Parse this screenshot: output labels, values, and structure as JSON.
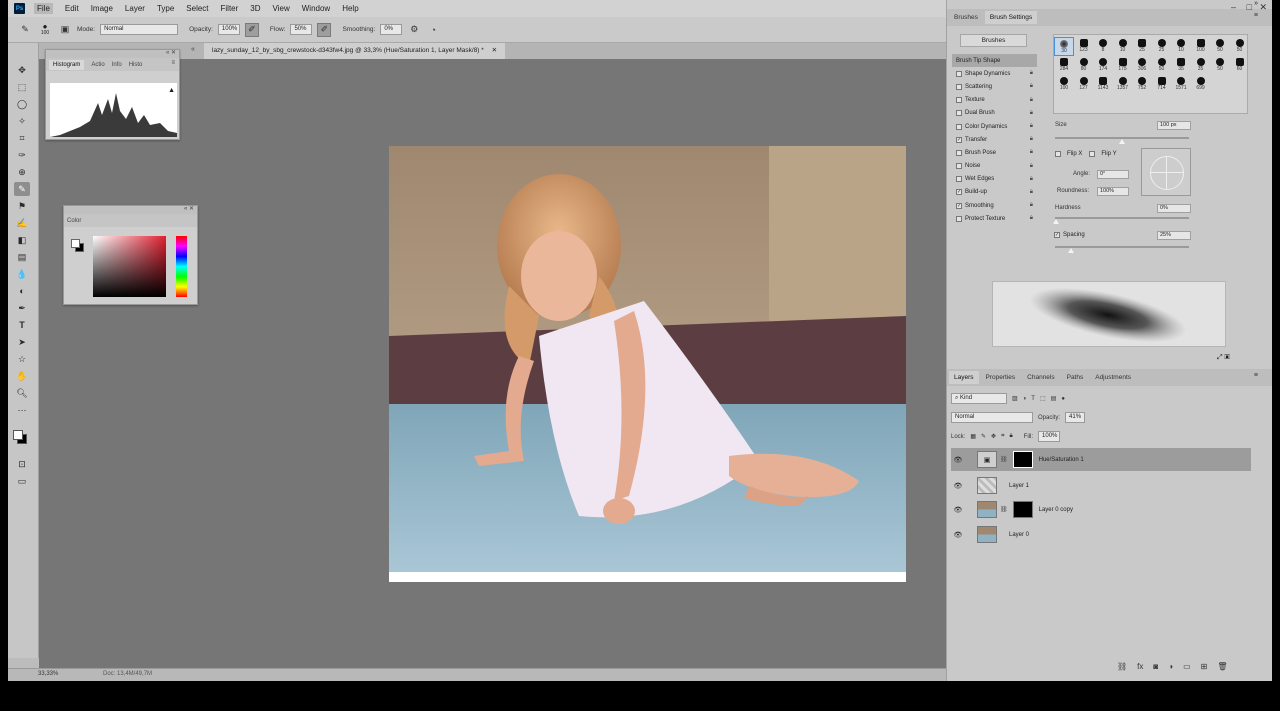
{
  "menubar": {
    "app_logo": "Ps",
    "items": [
      "File",
      "Edit",
      "Image",
      "Layer",
      "Type",
      "Select",
      "Filter",
      "3D",
      "View",
      "Window",
      "Help"
    ],
    "window_controls": [
      "–",
      "□",
      "✕"
    ]
  },
  "options": {
    "brush_size": "100",
    "mode_label": "Mode:",
    "mode_value": "Normal",
    "opacity_label": "Opacity:",
    "opacity_value": "100%",
    "flow_label": "Flow:",
    "flow_value": "50%",
    "smoothing_label": "Smoothing:",
    "smoothing_value": "0%"
  },
  "document": {
    "tab_title": "lazy_sunday_12_by_sbg_crewstock-d343fw4.jpg @ 33,3% (Hue/Saturation 1, Layer Mask/8) *",
    "close": "✕",
    "prev_arrow": "«"
  },
  "status": {
    "zoom": "33,33%",
    "doc_info": "Doc: 13,4M/49,7M"
  },
  "histogram_panel": {
    "tabs": [
      "Histogram",
      "Actio",
      "Info",
      "Histo"
    ],
    "warning": "▲"
  },
  "color_panel": {
    "tab": "Color"
  },
  "brush_settings": {
    "tabs": [
      "Brushes",
      "Brush Settings"
    ],
    "brushes_button": "Brushes",
    "options": [
      {
        "label": "Brush Tip Shape",
        "checked": null,
        "active": true
      },
      {
        "label": "Shape Dynamics",
        "checked": false
      },
      {
        "label": "Scattering",
        "checked": false
      },
      {
        "label": "Texture",
        "checked": false
      },
      {
        "label": "Dual Brush",
        "checked": false
      },
      {
        "label": "Color Dynamics",
        "checked": false
      },
      {
        "label": "Transfer",
        "checked": true
      },
      {
        "label": "Brush Pose",
        "checked": false
      },
      {
        "label": "Noise",
        "checked": false
      },
      {
        "label": "Wet Edges",
        "checked": false
      },
      {
        "label": "Build-up",
        "checked": true
      },
      {
        "label": "Smoothing",
        "checked": true
      },
      {
        "label": "Protect Texture",
        "checked": false
      }
    ],
    "tips": [
      "30",
      "123",
      "8",
      "10",
      "25",
      "25",
      "10",
      "100",
      "50",
      "50",
      "284",
      "80",
      "174",
      "175",
      "306",
      "50",
      "35",
      "35",
      "50",
      "60",
      "100",
      "127",
      "1143",
      "1357",
      "752",
      "714",
      "1571",
      "699"
    ],
    "size_label": "Size",
    "size_value": "100 px",
    "flip_x": "Flip X",
    "flip_y": "Flip Y",
    "angle_label": "Angle:",
    "angle_value": "0°",
    "roundness_label": "Roundness:",
    "roundness_value": "100%",
    "hardness_label": "Hardness",
    "hardness_value": "0%",
    "spacing_label": "Spacing",
    "spacing_value": "25%"
  },
  "layers_panel": {
    "tabs": [
      "Layers",
      "Properties",
      "Channels",
      "Paths",
      "Adjustments"
    ],
    "kind_label": "Kind",
    "blend_mode": "Normal",
    "opacity_label": "Opacity:",
    "opacity_value": "41%",
    "lock_label": "Lock:",
    "fill_label": "Fill:",
    "fill_value": "100%",
    "layers": [
      {
        "name": "Hue/Saturation 1",
        "selected": true
      },
      {
        "name": "Layer 1",
        "selected": false
      },
      {
        "name": "Layer 0 copy",
        "selected": false
      },
      {
        "name": "Layer 0",
        "selected": false
      }
    ]
  }
}
